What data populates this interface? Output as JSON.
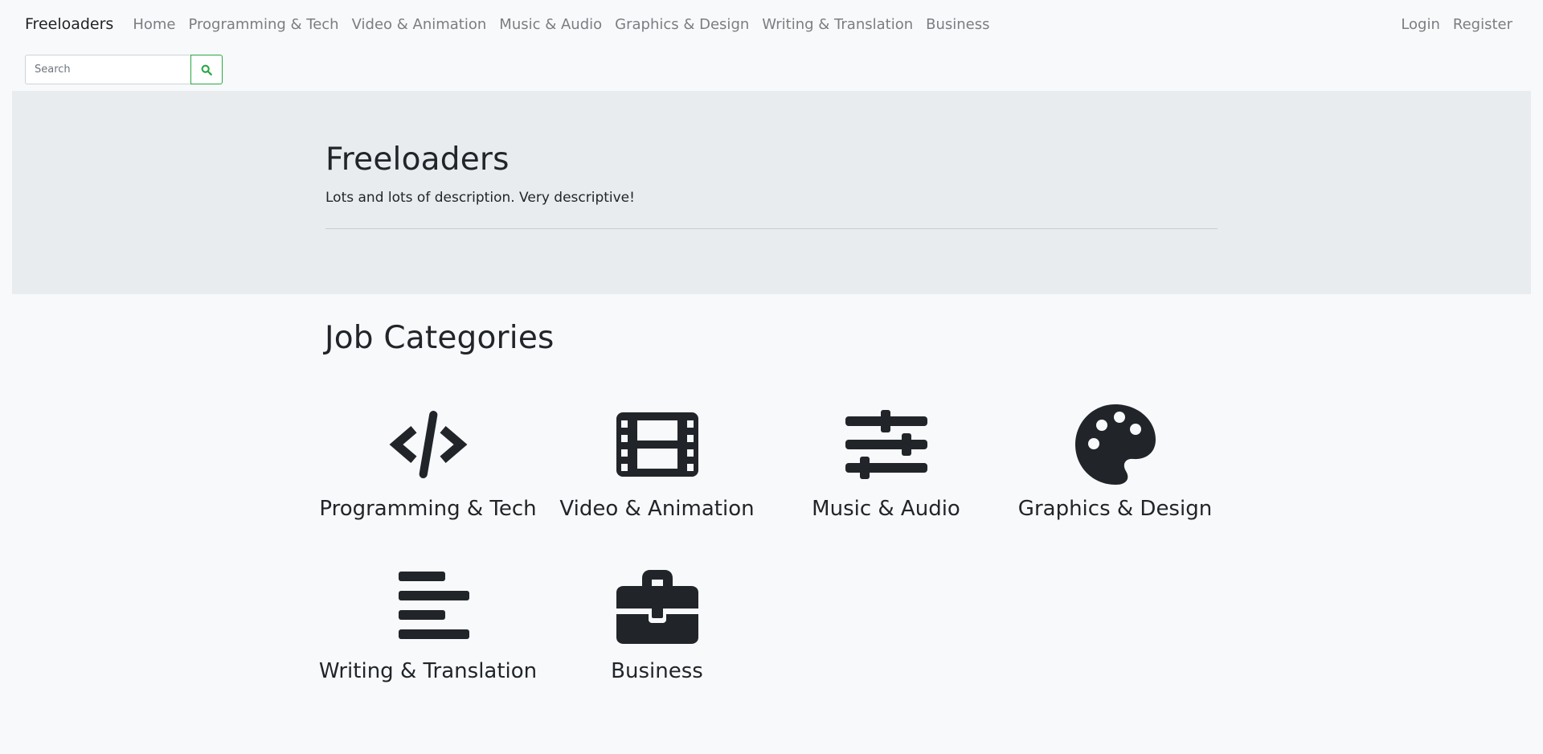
{
  "navbar": {
    "brand": "Freeloaders",
    "links": [
      "Home",
      "Programming & Tech",
      "Video & Animation",
      "Music & Audio",
      "Graphics & Design",
      "Writing & Translation",
      "Business"
    ],
    "login": "Login",
    "register": "Register"
  },
  "search": {
    "placeholder": "Search",
    "value": "",
    "button_icon": "search-icon",
    "accent": "#28a745"
  },
  "hero": {
    "title": "Freeloaders",
    "lead": "Lots and lots of description. Very descriptive!"
  },
  "categories": {
    "title": "Job Categories",
    "items": [
      {
        "label": "Programming & Tech",
        "icon": "code-icon"
      },
      {
        "label": "Video & Animation",
        "icon": "film-icon"
      },
      {
        "label": "Music & Audio",
        "icon": "sliders-icon"
      },
      {
        "label": "Graphics & Design",
        "icon": "palette-icon"
      },
      {
        "label": "Writing & Translation",
        "icon": "align-left-icon"
      },
      {
        "label": "Business",
        "icon": "briefcase-icon"
      }
    ]
  },
  "colors": {
    "background": "#f8f9fa",
    "hero_background": "#e9ecef",
    "text": "#212529",
    "nav_link": "#7a7e82"
  }
}
